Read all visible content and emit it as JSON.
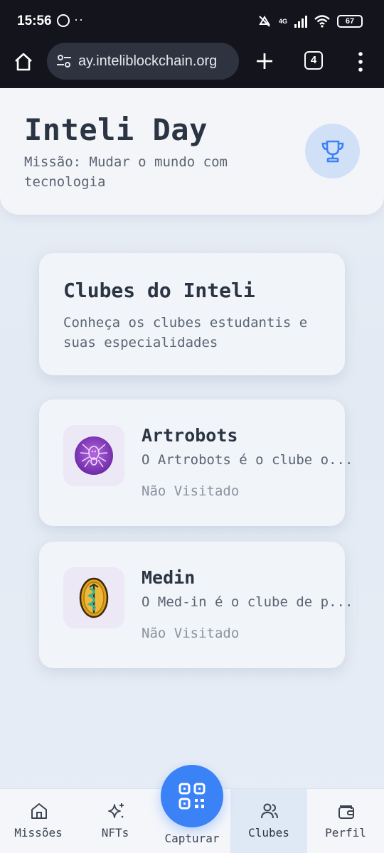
{
  "status_bar": {
    "time": "15:56",
    "network": "4G",
    "battery": "67"
  },
  "browser": {
    "url": "ay.inteliblockchain.org",
    "tab_count": "4"
  },
  "header": {
    "title": "Inteli Day",
    "subtitle": "Missão: Mudar o mundo com tecnologia"
  },
  "intro": {
    "title": "Clubes do Inteli",
    "description": "Conheça os clubes estudantis e suas especialidades"
  },
  "clubs": [
    {
      "name": "Artrobots",
      "description": "O Artrobots é o clube o...",
      "status": "Não Visitado",
      "logo": "spider-robot-logo"
    },
    {
      "name": "Medin",
      "description": "O Med-in é o clube de p...",
      "status": "Não Visitado",
      "logo": "caduceus-coin-logo"
    }
  ],
  "nav": {
    "missoes": "Missões",
    "nfts": "NFTs",
    "capturar": "Capturar",
    "clubes": "Clubes",
    "perfil": "Perfil",
    "active": "Clubes"
  },
  "colors": {
    "accent": "#3b82f6",
    "trophy_bg": "#cfe0f7",
    "active_nav_bg": "#dfe8f5"
  }
}
